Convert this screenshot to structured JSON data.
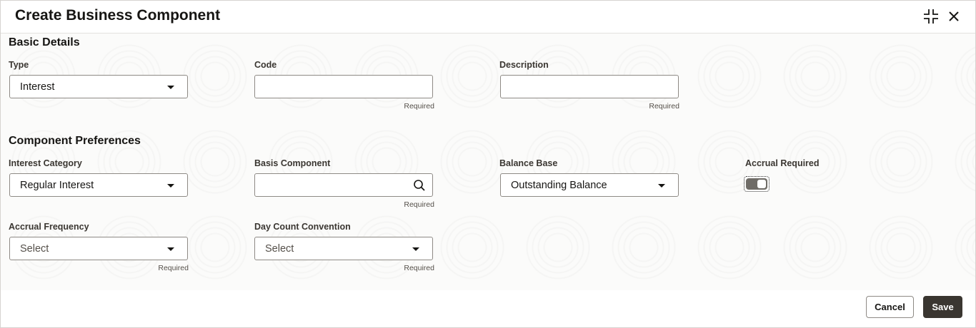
{
  "dialog": {
    "title": "Create Business Component"
  },
  "basic_details": {
    "section_title": "Basic Details",
    "type": {
      "label": "Type",
      "value": "Interest"
    },
    "code": {
      "label": "Code",
      "value": "",
      "hint": "Required"
    },
    "description": {
      "label": "Description",
      "value": "",
      "hint": "Required"
    }
  },
  "preferences": {
    "section_title": "Component Preferences",
    "interest_category": {
      "label": "Interest Category",
      "value": "Regular Interest"
    },
    "basis_component": {
      "label": "Basis Component",
      "value": "",
      "hint": "Required"
    },
    "balance_base": {
      "label": "Balance Base",
      "value": "Outstanding Balance"
    },
    "accrual_required": {
      "label": "Accrual Required",
      "checked": true
    },
    "accrual_frequency": {
      "label": "Accrual Frequency",
      "value": "Select",
      "hint": "Required"
    },
    "day_count_convention": {
      "label": "Day Count Convention",
      "value": "Select",
      "hint": "Required"
    }
  },
  "footer": {
    "cancel_label": "Cancel",
    "save_label": "Save"
  },
  "icons": {
    "collapse": "collapse-icon",
    "close": "close-icon",
    "dropdown": "chevron-down-icon",
    "search": "search-icon"
  },
  "colors": {
    "primary_button": "#3a3631",
    "toggle_on": "#6f6c67"
  }
}
